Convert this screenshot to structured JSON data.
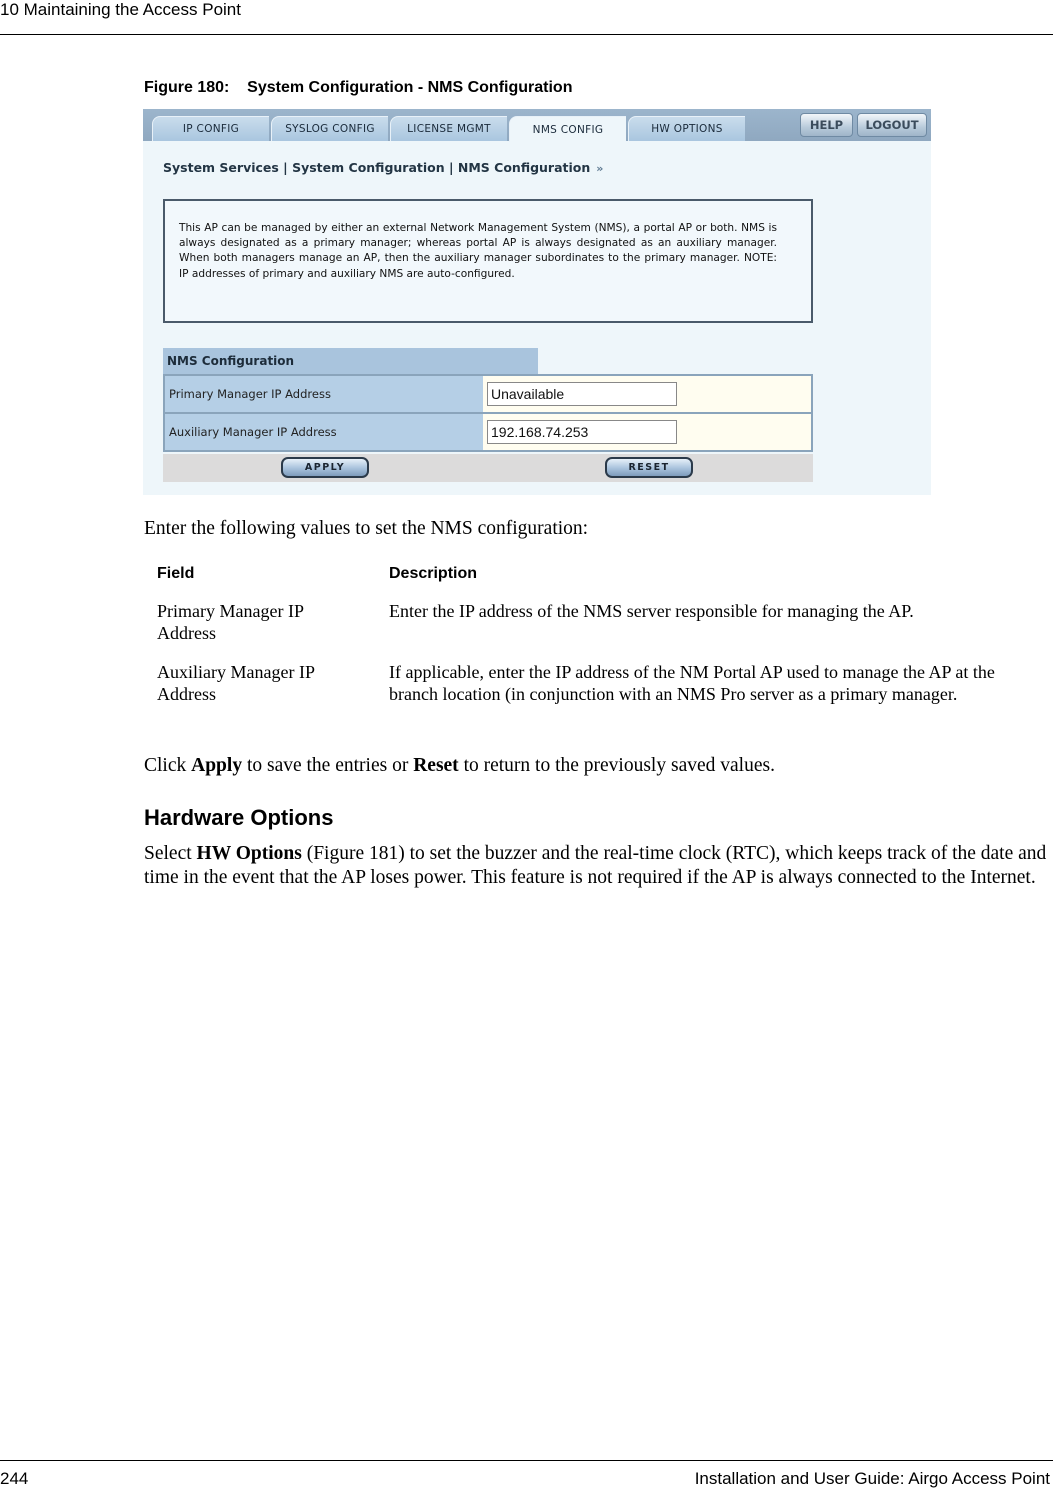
{
  "header": {
    "running_title": "10  Maintaining the Access Point"
  },
  "figure": {
    "caption": "Figure 180:    System Configuration - NMS Configuration",
    "ui": {
      "tabs": [
        {
          "label": "IP CONFIG",
          "active": false
        },
        {
          "label": "SYSLOG CONFIG",
          "active": false
        },
        {
          "label": "LICENSE MGMT",
          "active": false
        },
        {
          "label": "NMS CONFIG",
          "active": true
        },
        {
          "label": "HW OPTIONS",
          "active": false
        }
      ],
      "help_label": "HELP",
      "logout_label": "LOGOUT",
      "breadcrumb": "System Services | System Configuration | NMS Configuration",
      "breadcrumb_arrow": "»",
      "info_text": "This AP can be managed by either an external Network Management System (NMS), a portal AP or both. NMS is always designated as a primary manager; whereas portal AP is always designated as an auxiliary manager. When both managers manage an AP, then the auxiliary manager subordinates to the primary manager. NOTE: IP addresses of primary and auxiliary NMS are auto-configured.",
      "section_title": "NMS Configuration",
      "fields": [
        {
          "label": "Primary Manager IP Address",
          "value": "Unavailable"
        },
        {
          "label": "Auxiliary Manager IP Address",
          "value": "192.168.74.253"
        }
      ],
      "apply_label": "APPLY",
      "reset_label": "RESET"
    }
  },
  "body": {
    "intro": "Enter the following values to set the NMS configuration:",
    "table": {
      "headers": [
        "Field",
        "Description"
      ],
      "rows": [
        {
          "field": "Primary Manager IP Address",
          "description": "Enter the IP address of the NMS server responsible for managing the AP."
        },
        {
          "field": "Auxiliary Manager IP Address",
          "description": "If applicable, enter the IP address of the NM Portal AP used to manage the AP at the branch location (in conjunction with an NMS Pro server as a primary manager."
        }
      ]
    },
    "apply_note": {
      "pre": "Click ",
      "apply": "Apply",
      "mid": " to save the entries or ",
      "reset": "Reset",
      "post": " to return to the previously saved values."
    },
    "hw_section_title": "Hardware Options",
    "hw_para": {
      "pre": "Select ",
      "bold": "HW Options",
      "post": " (Figure 181) to set the buzzer and the real-time clock (RTC), which keeps track of the date and time in the event that the AP loses power. This feature is not required if the AP is always connected to the Internet."
    }
  },
  "footer": {
    "page_number": "244",
    "guide_title": "Installation and User Guide: Airgo Access Point"
  }
}
